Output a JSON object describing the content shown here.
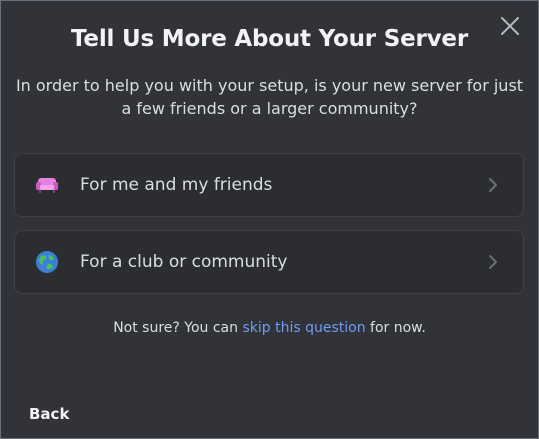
{
  "modal": {
    "title": "Tell Us More About Your Server",
    "subtitle": "In order to help you with your setup, is your new server for just a few friends or a larger community?",
    "close_icon": "close-icon"
  },
  "options": [
    {
      "label": "For me and my friends",
      "icon": "couch-icon"
    },
    {
      "label": "For a club or community",
      "icon": "globe-icon"
    }
  ],
  "note": {
    "prefix": "Not sure? You can ",
    "link": "skip this question",
    "suffix": " for now."
  },
  "footer": {
    "back_label": "Back"
  },
  "colors": {
    "background": "#313338",
    "card": "#2b2d31",
    "link": "#6f9cf0",
    "text": "#dbdee1"
  }
}
